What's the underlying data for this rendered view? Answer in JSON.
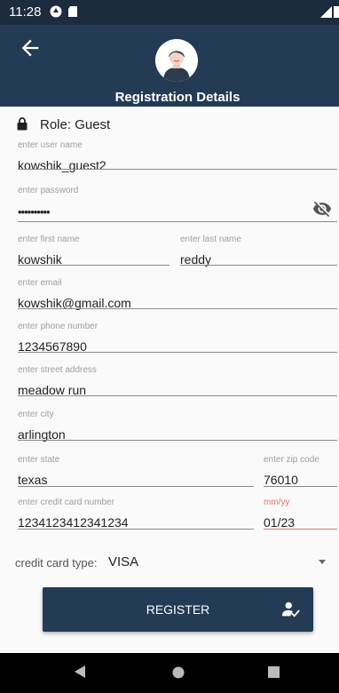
{
  "status": {
    "time": "11:28"
  },
  "header": {
    "title": "Registration Details"
  },
  "role": {
    "label": "Role:",
    "value": "Guest"
  },
  "fields": {
    "username": {
      "placeholder": "enter user name",
      "value": "kowshik_guest2"
    },
    "password": {
      "placeholder": "enter password",
      "value": "••••••••••"
    },
    "firstname": {
      "placeholder": "enter first name",
      "value": "kowshik"
    },
    "lastname": {
      "placeholder": "enter last name",
      "value": "reddy"
    },
    "email": {
      "placeholder": "enter email",
      "value": "kowshik@gmail.com"
    },
    "phone": {
      "placeholder": "enter phone number",
      "value": "1234567890"
    },
    "street": {
      "placeholder": "enter street address",
      "value": "meadow run"
    },
    "city": {
      "placeholder": "enter city",
      "value": "arlington"
    },
    "state": {
      "placeholder": "enter state",
      "value": "texas"
    },
    "zip": {
      "placeholder": "enter zip code",
      "value": "76010"
    },
    "ccnumber": {
      "placeholder": "enter credit card number",
      "value": "1234123412341234"
    },
    "expiry": {
      "placeholder": "mm/yy",
      "value": "01/23"
    }
  },
  "cctype": {
    "label": "credit card type:",
    "selected": "VISA"
  },
  "register": {
    "label": "REGISTER"
  },
  "colors": {
    "primary": "#243b55",
    "error": "#e57373",
    "statusbar": "#1c2b3d"
  },
  "icons": [
    "back-arrow-icon",
    "avatar-icon",
    "lock-icon",
    "eye-off-icon",
    "dropdown-arrow-icon",
    "person-check-icon",
    "nav-back-icon",
    "nav-home-icon",
    "nav-recents-icon"
  ]
}
